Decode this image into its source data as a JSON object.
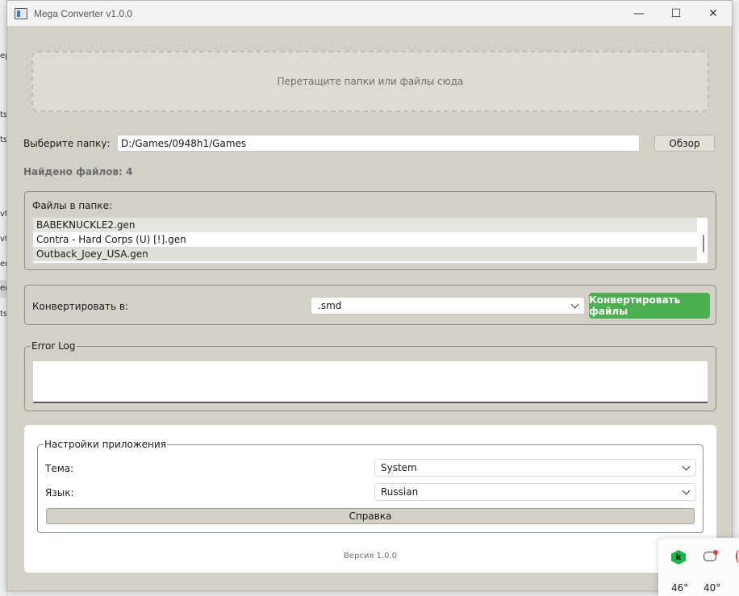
{
  "background": {
    "fragments": [
      "ер",
      "ts_",
      "ts_",
      "vt",
      "vt",
      "en",
      "en",
      "ts_"
    ]
  },
  "window": {
    "title": "Mega Converter v1.0.0",
    "controls": {
      "minimize": "—",
      "maximize": "☐",
      "close": "✕"
    }
  },
  "dropzone": {
    "text": "Перетащите папки или файлы сюда"
  },
  "folder": {
    "label": "Выберите папку:",
    "path": "D:/Games/0948h1/Games",
    "browse": "Обзор"
  },
  "found": "Найдено файлов: 4",
  "files": {
    "title": "Файлы в папке:",
    "items": [
      "BABEKNUCKLE2.gen",
      "Contra - Hard Corps (U) [!].gen",
      "Outback_Joey_USA.gen"
    ]
  },
  "convert": {
    "label": "Конвертировать в:",
    "format": ".smd",
    "button": "Конвертировать файлы",
    "button_color": "#4caf50"
  },
  "error_log": {
    "title": "Error Log",
    "content": ""
  },
  "settings": {
    "title": "Настройки приложения",
    "theme_label": "Тема:",
    "theme_value": "System",
    "language_label": "Язык:",
    "language_value": "Russian",
    "help": "Справка"
  },
  "version": "Версия 1.0.0",
  "tray": {
    "k_label": "k",
    "temp1": "46°",
    "temp2": "40°"
  }
}
